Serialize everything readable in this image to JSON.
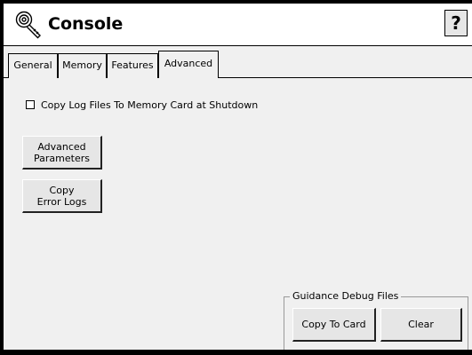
{
  "titlebar": {
    "title": "Console",
    "help_label": "?",
    "icon": "wrench-key-icon"
  },
  "tabs": [
    {
      "label": "General",
      "active": false
    },
    {
      "label": "Memory",
      "active": false
    },
    {
      "label": "Features",
      "active": false
    },
    {
      "label": "Advanced",
      "active": true
    }
  ],
  "advanced": {
    "copy_logs_checkbox": {
      "label": "Copy Log Files To Memory Card at Shutdown",
      "checked": false
    },
    "advanced_parameters_button": {
      "line1": "Advanced",
      "line2": "Parameters"
    },
    "copy_error_logs_button": {
      "line1": "Copy",
      "line2": "Error Logs"
    },
    "guidance_debug": {
      "group_label": "Guidance Debug Files",
      "copy_to_card_label": "Copy To Card",
      "clear_label": "Clear"
    }
  },
  "colors": {
    "background": "#f0f0f0",
    "button": "#e6e6e6",
    "titlebar": "#ffffff",
    "frame": "#000000"
  }
}
